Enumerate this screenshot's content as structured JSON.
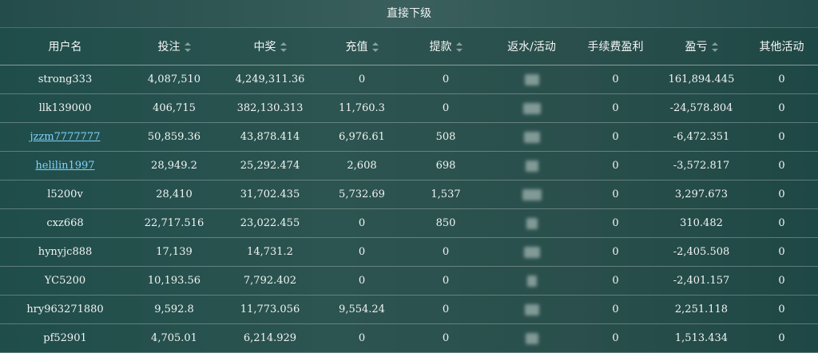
{
  "title": "直接下级",
  "columns": [
    {
      "label": "用户名",
      "sortable": false
    },
    {
      "label": "投注",
      "sortable": true
    },
    {
      "label": "中奖",
      "sortable": true
    },
    {
      "label": "充值",
      "sortable": true
    },
    {
      "label": "提款",
      "sortable": true
    },
    {
      "label": "返水/活动",
      "sortable": false
    },
    {
      "label": "手续费盈利",
      "sortable": false
    },
    {
      "label": "盈亏",
      "sortable": true
    },
    {
      "label": "其他活动",
      "sortable": false
    }
  ],
  "rows": [
    {
      "user": "strong333",
      "link": false,
      "bet": "4,087,510",
      "win": "4,249,311.36",
      "deposit": "0",
      "withdraw": "0",
      "fee": "0",
      "pnl": "161,894.445",
      "other": "0"
    },
    {
      "user": "llk139000",
      "link": false,
      "bet": "406,715",
      "win": "382,130.313",
      "deposit": "11,760.3",
      "withdraw": "0",
      "fee": "0",
      "pnl": "-24,578.804",
      "other": "0"
    },
    {
      "user": "jzzm7777777",
      "link": true,
      "bet": "50,859.36",
      "win": "43,878.414",
      "deposit": "6,976.61",
      "withdraw": "508",
      "fee": "0",
      "pnl": "-6,472.351",
      "other": "0"
    },
    {
      "user": "helilin1997",
      "link": true,
      "bet": "28,949.2",
      "win": "25,292.474",
      "deposit": "2,608",
      "withdraw": "698",
      "fee": "0",
      "pnl": "-3,572.817",
      "other": "0"
    },
    {
      "user": "l5200v",
      "link": false,
      "bet": "28,410",
      "win": "31,702.435",
      "deposit": "5,732.69",
      "withdraw": "1,537",
      "fee": "0",
      "pnl": "3,297.673",
      "other": "0"
    },
    {
      "user": "cxz668",
      "link": false,
      "bet": "22,717.516",
      "win": "23,022.455",
      "deposit": "0",
      "withdraw": "850",
      "fee": "0",
      "pnl": "310.482",
      "other": "0"
    },
    {
      "user": "hynyjc888",
      "link": false,
      "bet": "17,139",
      "win": "14,731.2",
      "deposit": "0",
      "withdraw": "0",
      "fee": "0",
      "pnl": "-2,405.508",
      "other": "0"
    },
    {
      "user": "YC5200",
      "link": false,
      "bet": "10,193.56",
      "win": "7,792.402",
      "deposit": "0",
      "withdraw": "0",
      "fee": "0",
      "pnl": "-2,401.157",
      "other": "0"
    },
    {
      "user": "hry963271880",
      "link": false,
      "bet": "9,592.8",
      "win": "11,773.056",
      "deposit": "9,554.24",
      "withdraw": "0",
      "fee": "0",
      "pnl": "2,251.118",
      "other": "0"
    },
    {
      "user": "pf52901",
      "link": false,
      "bet": "4,705.01",
      "win": "6,214.929",
      "deposit": "0",
      "withdraw": "0",
      "fee": "0",
      "pnl": "1,513.434",
      "other": "0"
    }
  ]
}
